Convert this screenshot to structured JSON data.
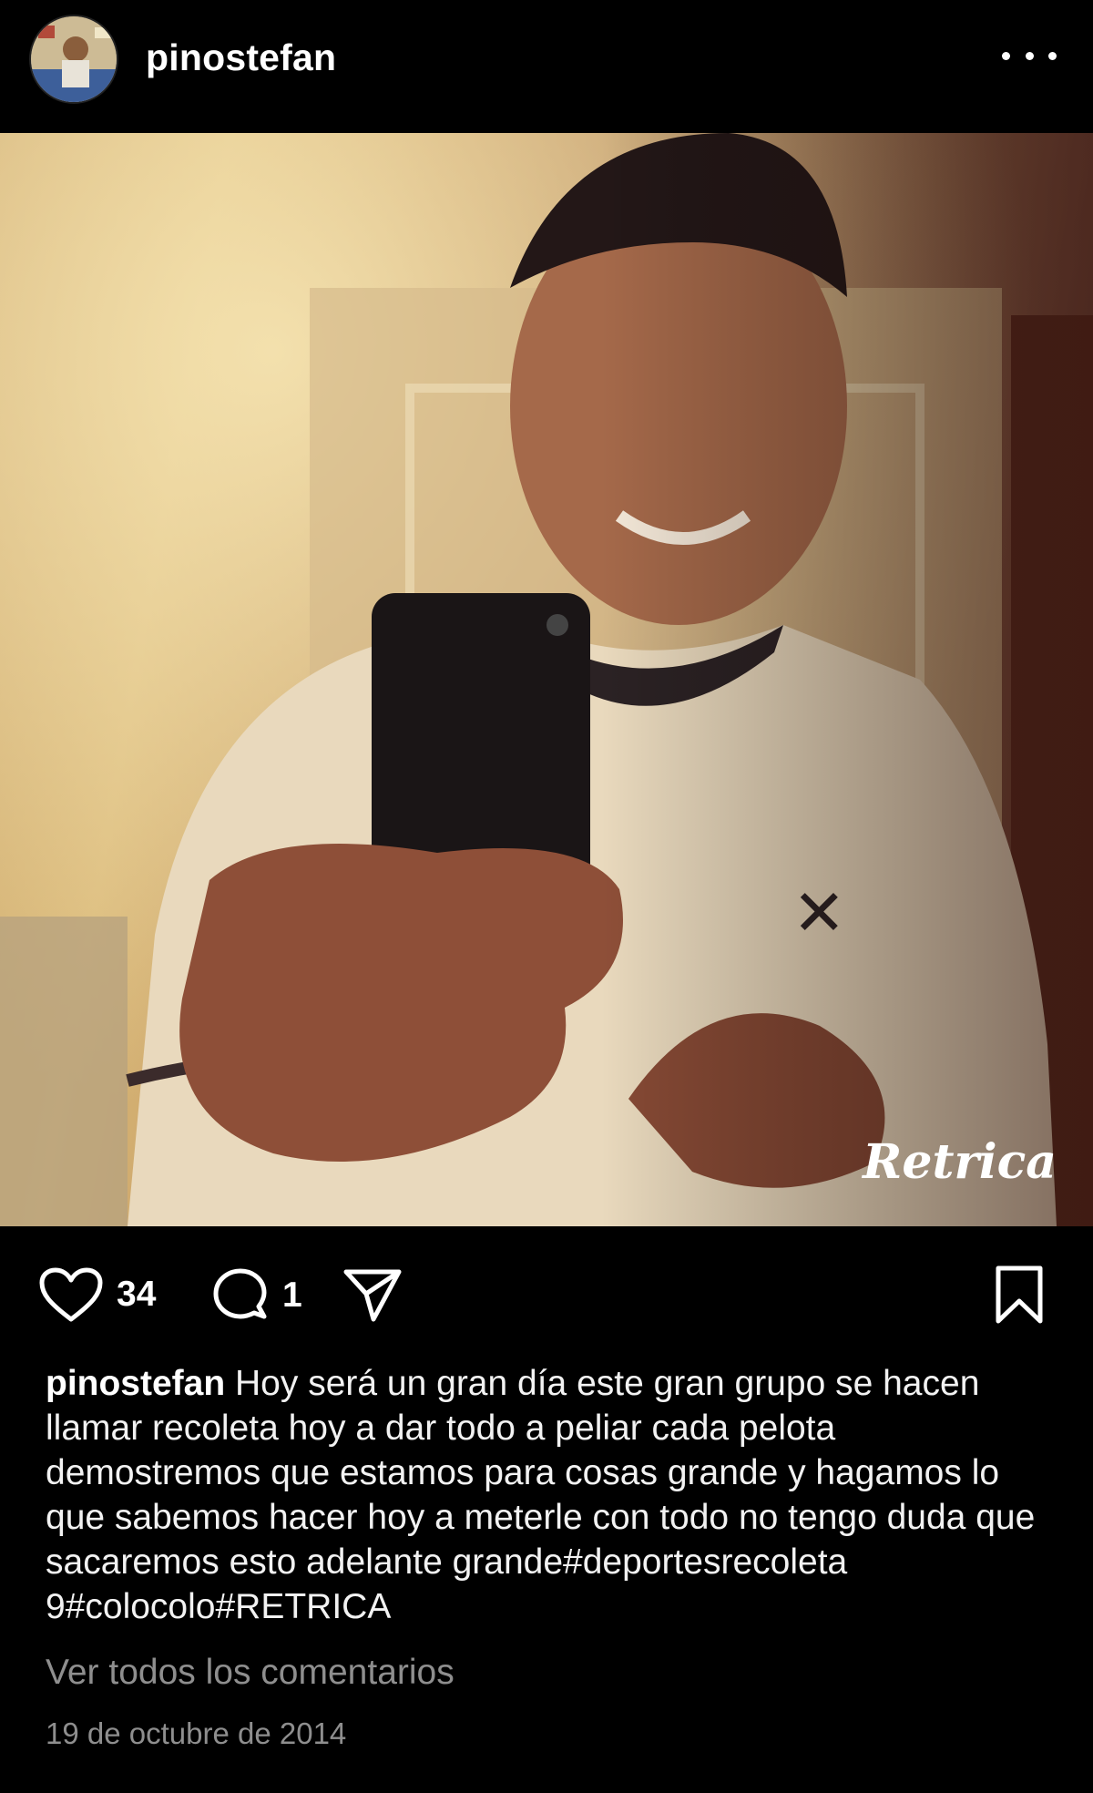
{
  "header": {
    "username": "pinostefan",
    "avatar_icon": "profile-avatar",
    "more_icon": "more-options-icon"
  },
  "post": {
    "image_description_icon": "post-photo",
    "watermark": "Retrica"
  },
  "actions": {
    "likes": "34",
    "comments": "1",
    "like_icon": "heart-icon",
    "comment_icon": "comment-icon",
    "share_icon": "send-icon",
    "save_icon": "bookmark-icon"
  },
  "caption": {
    "username": "pinostefan",
    "text": "Hoy será un gran día este gran grupo se hacen llamar recoleta hoy a dar todo a peliar cada pelota demostremos que estamos para cosas grande y hagamos lo que sabemos hacer hoy a meterle con todo no tengo duda que sacaremos esto adelante grande#deportesrecoleta 9#colocolo#RETRICA"
  },
  "view_all_comments": "Ver todos los comentarios",
  "date": "19 de octubre de 2014",
  "colors": {
    "background": "#000000",
    "text": "#f5f5f5",
    "muted": "#8e8e8e"
  }
}
